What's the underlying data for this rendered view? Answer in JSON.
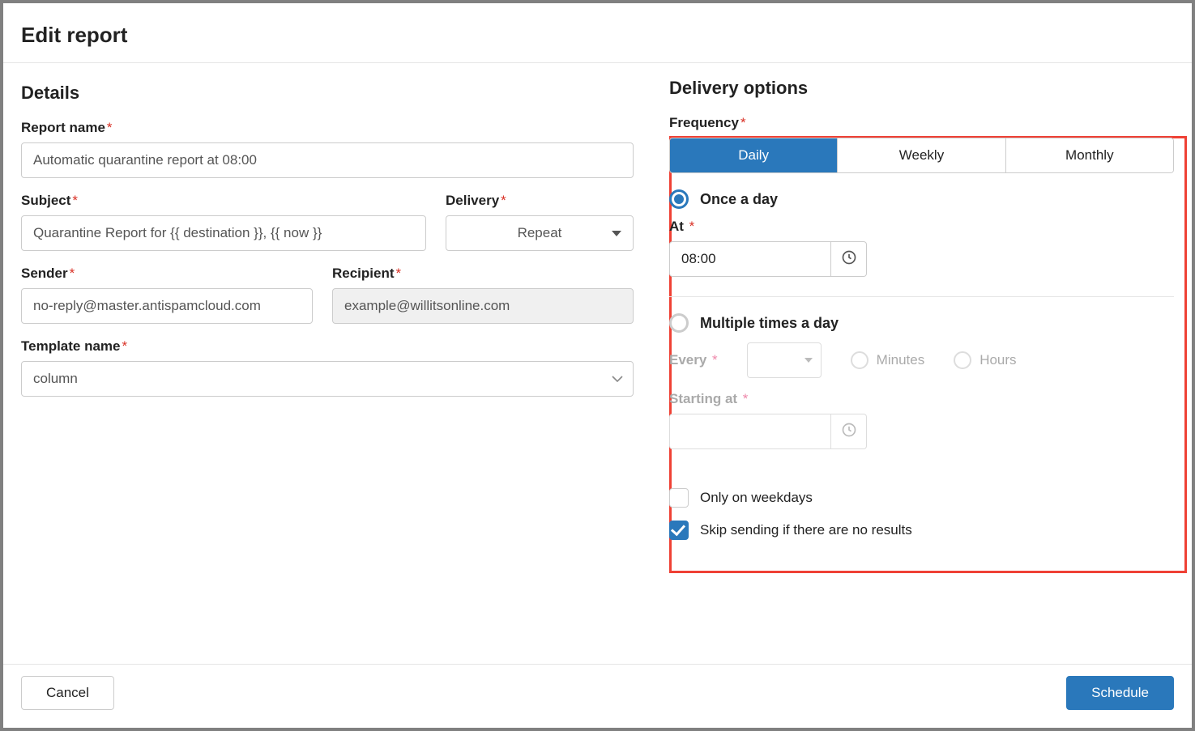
{
  "modal": {
    "title": "Edit report",
    "details": {
      "section_title": "Details",
      "report_name_label": "Report name",
      "report_name_value": "Automatic quarantine report at 08:00",
      "subject_label": "Subject",
      "subject_value": "Quarantine Report for {{ destination }}, {{ now }}",
      "delivery_label": "Delivery",
      "delivery_value": "Repeat",
      "sender_label": "Sender",
      "sender_value": "no-reply@master.antispamcloud.com",
      "recipient_label": "Recipient",
      "recipient_value": "example@willitsonline.com",
      "template_label": "Template name",
      "template_value": "column"
    },
    "delivery_options": {
      "section_title": "Delivery options",
      "frequency_label": "Frequency",
      "tabs": {
        "daily": "Daily",
        "weekly": "Weekly",
        "monthly": "Monthly",
        "selected": "daily"
      },
      "once_label": "Once a day",
      "at_label": "At",
      "at_value": "08:00",
      "multiple_label": "Multiple times a day",
      "every_label": "Every",
      "minutes_label": "Minutes",
      "hours_label": "Hours",
      "starting_at_label": "Starting at",
      "only_weekdays_label": "Only on weekdays",
      "only_weekdays_checked": false,
      "skip_label": "Skip sending if there are no results",
      "skip_checked": true
    },
    "footer": {
      "cancel": "Cancel",
      "schedule": "Schedule"
    }
  }
}
